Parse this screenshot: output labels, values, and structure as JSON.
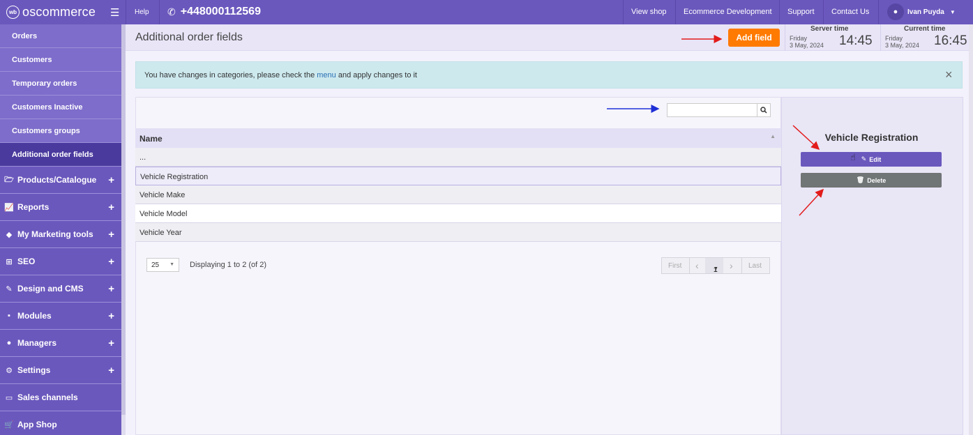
{
  "topbar": {
    "logo_mark": "wb",
    "logo_text": "oscommerce",
    "help": "Help",
    "phone": "+448000112569",
    "links": [
      "View shop",
      "Ecommerce Development",
      "Support",
      "Contact Us"
    ],
    "user_name": "Ivan Puyda"
  },
  "sidebar": {
    "sub_items": [
      "Orders",
      "Customers",
      "Temporary orders",
      "Customers Inactive",
      "Customers groups",
      "Additional order fields"
    ],
    "active_sub": "Additional order fields",
    "main_items": [
      {
        "label": "Products/Catalogue",
        "icon": "folder-icon"
      },
      {
        "label": "Reports",
        "icon": "chart-icon"
      },
      {
        "label": "My Marketing tools",
        "icon": "tag-icon"
      },
      {
        "label": "SEO",
        "icon": "sitemap-icon"
      },
      {
        "label": "Design and CMS",
        "icon": "brush-icon"
      },
      {
        "label": "Modules",
        "icon": "modules-icon"
      },
      {
        "label": "Managers",
        "icon": "user-icon"
      },
      {
        "label": "Settings",
        "icon": "gears-icon"
      },
      {
        "label": "Sales channels",
        "icon": "monitor-icon"
      },
      {
        "label": "App Shop",
        "icon": "cart-icon"
      }
    ]
  },
  "header": {
    "title": "Additional order fields",
    "add_field": "Add field",
    "server_time": {
      "label": "Server time",
      "day": "Friday",
      "date": "3 May, 2024",
      "time": "14:45"
    },
    "current_time": {
      "label": "Current time",
      "day": "Friday",
      "date": "3 May, 2024",
      "time": "16:45"
    }
  },
  "alert": {
    "text_before": "You have changes in categories, please check the ",
    "link": "menu",
    "text_after": " and apply changes to it",
    "close": "×"
  },
  "table": {
    "search_placeholder": "",
    "column": "Name",
    "rows": [
      "...",
      "Vehicle Registration",
      "Vehicle Make",
      "Vehicle Model",
      "Vehicle Year"
    ],
    "selected_row": "Vehicle Registration"
  },
  "pagination": {
    "per_page": "25",
    "displaying": "Displaying 1 to 2 (of 2)",
    "first": "First",
    "prev": "‹",
    "current": "1",
    "next": "›",
    "last": "Last"
  },
  "details": {
    "title": "Vehicle Registration",
    "edit": "Edit",
    "delete": "Delete"
  },
  "colors": {
    "topbar": "#6b58bd",
    "sidebar_active": "#4a3a9e",
    "accent_orange": "#ff7a00",
    "annotation_red": "#e21b1b",
    "annotation_blue": "#1f2fd6"
  }
}
